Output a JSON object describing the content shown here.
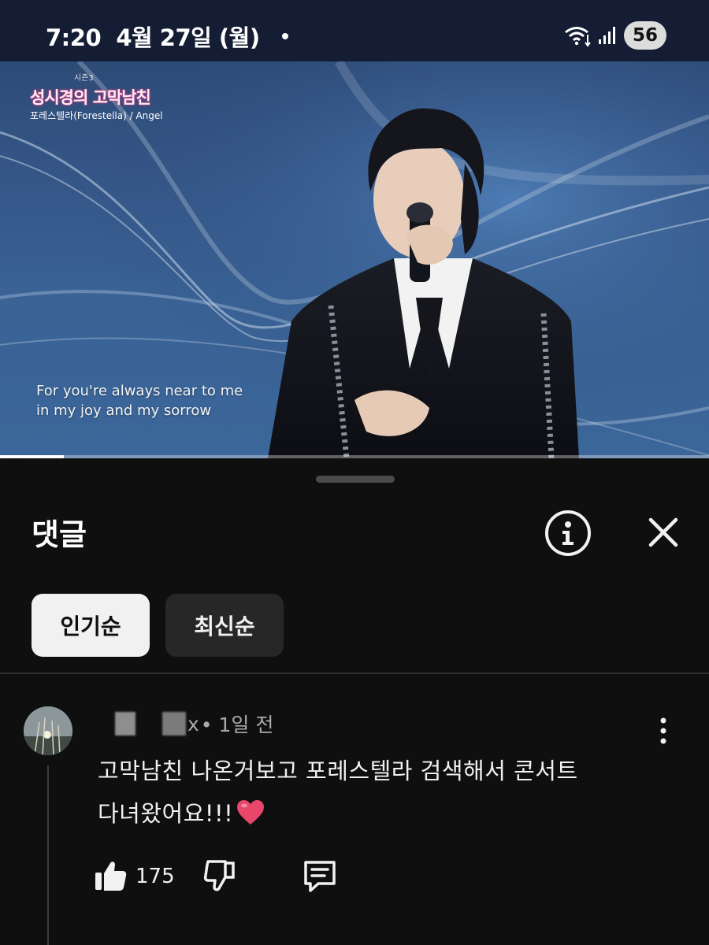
{
  "status_bar": {
    "time": "7:20",
    "date": "4월 27일 (월)",
    "battery": "56",
    "icons": [
      "wifi-icon",
      "signal-icon"
    ]
  },
  "video": {
    "show_logo_top": "시즌3",
    "show_logo": "성시경의 고막남친",
    "subtitle": "포레스텔라(Forestella) / Angel",
    "lyrics": [
      "For you're always near to me",
      "in my joy and my sorrow"
    ],
    "progress": 0.09
  },
  "comments_panel": {
    "title": "댓글",
    "icons": [
      "info-icon",
      "close-icon"
    ],
    "sort_chips": [
      {
        "label": "인기순",
        "selected": true
      },
      {
        "label": "최신순",
        "selected": false
      }
    ],
    "comment": {
      "author_suffix": "x",
      "time": "• 1일 전",
      "text_lines": [
        "고막남친 나온거보고 포레스텔라 검색해서 콘서트",
        "다녀왔어요!!!"
      ],
      "emoji": "heart",
      "likes": "175"
    }
  },
  "colors": {
    "background": "#0f0f0f",
    "status_bar": "#141d33",
    "chip_selected": "#f1f1f1",
    "chip_unselected": "#272727",
    "heart": "#e8476a"
  }
}
